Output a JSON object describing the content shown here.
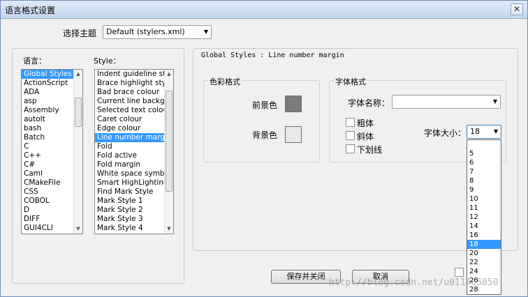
{
  "window": {
    "title": "语言格式设置",
    "close": "✕"
  },
  "theme": {
    "label": "选择主题",
    "value": "Default (stylers.xml)"
  },
  "languages": {
    "label": "语言：",
    "items": [
      "Global Styles",
      "ActionScript",
      "ADA",
      "asp",
      "Assembly",
      "autoIt",
      "bash",
      "Batch",
      "C",
      "C++",
      "C#",
      "Caml",
      "CMakeFile",
      "CSS",
      "COBOL",
      "D",
      "DIFF",
      "GUI4CLI"
    ],
    "selected": 0
  },
  "styles": {
    "label": "Style：",
    "items": [
      "Indent guideline sty",
      "Brace highlight style",
      "Bad brace colour",
      "Current line backgr",
      "Selected text colour",
      "Caret colour",
      "Edge colour",
      "Line number margin",
      "Fold",
      "Fold active",
      "Fold margin",
      "White space symbo",
      "Smart HighLighting",
      "Find Mark Style",
      "Mark Style 1",
      "Mark Style 2",
      "Mark Style 3",
      "Mark Style 4"
    ],
    "selected": 7
  },
  "detail": {
    "header": "Global Styles : Line number margin",
    "colour_group": {
      "title": "色彩格式",
      "fg_label": "前景色",
      "bg_label": "背景色",
      "fg_color": "#7b7b7b",
      "bg_color": "#e8e8e8"
    },
    "font_group": {
      "title": "字体格式",
      "name_label": "字体名称：",
      "name_value": "",
      "bold": "粗体",
      "italic": "斜体",
      "underline": "下划线",
      "size_label": "字体大小：",
      "size_value": "18",
      "size_options": [
        "5",
        "6",
        "7",
        "8",
        "9",
        "10",
        "11",
        "12",
        "14",
        "16",
        "18",
        "20",
        "22",
        "24",
        "26",
        "28"
      ],
      "size_selected": 10
    }
  },
  "buttons": {
    "save_close": "保存并关闭",
    "cancel": "取消"
  },
  "watermark": "http://blog.csdn.net/u011465850"
}
